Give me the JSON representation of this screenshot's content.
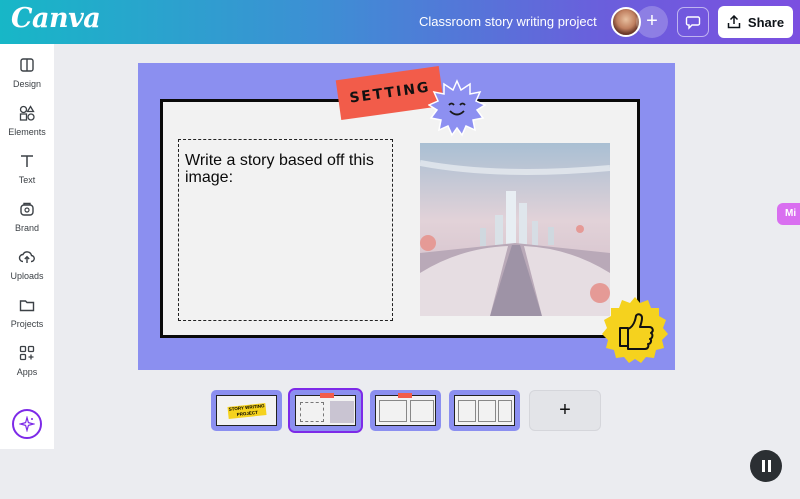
{
  "header": {
    "logo": "Canva",
    "doc_title": "Classroom story writing project",
    "add_collaborator_symbol": "+",
    "share_label": "Share"
  },
  "sidebar": {
    "items": [
      {
        "label": "Design",
        "icon": "layout-icon"
      },
      {
        "label": "Elements",
        "icon": "shapes-icon"
      },
      {
        "label": "Text",
        "icon": "text-icon"
      },
      {
        "label": "Brand",
        "icon": "brand-icon"
      },
      {
        "label": "Uploads",
        "icon": "upload-cloud-icon"
      },
      {
        "label": "Projects",
        "icon": "folder-icon"
      },
      {
        "label": "Apps",
        "icon": "apps-icon"
      }
    ],
    "magic_icon": "sparkle-icon"
  },
  "canvas": {
    "tag_label": "SETTING",
    "prompt_text": "Write a story based off this image:",
    "side_tab_label": "Mi"
  },
  "pages": {
    "thumbnail_1_text": "STORY WRITING PROJECT",
    "add_page_symbol": "+"
  },
  "colors": {
    "accent": "#7d2ae8",
    "slide_bg": "#8b8ff0",
    "tag": "#f25c4a",
    "sticker_yellow": "#f5d21e"
  }
}
